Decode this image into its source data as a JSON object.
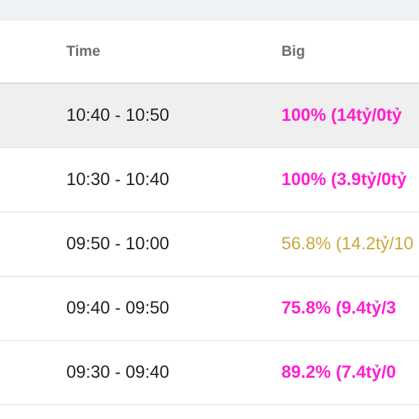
{
  "table": {
    "headers": {
      "time": "Time",
      "big": "Big"
    },
    "rows": [
      {
        "time": "10:40 - 10:50",
        "big": "100% (14tỷ/0tỷ",
        "status": "highlight",
        "selected": true
      },
      {
        "time": "10:30 - 10:40",
        "big": "100% (3.9tỷ/0tỷ",
        "status": "highlight",
        "selected": false
      },
      {
        "time": "09:50 - 10:00",
        "big": "56.8% (14.2tỷ/10",
        "status": "neutral",
        "selected": false
      },
      {
        "time": "09:40 - 09:50",
        "big": "75.8% (9.4tỷ/3",
        "status": "highlight",
        "selected": false
      },
      {
        "time": "09:30 - 09:40",
        "big": "89.2% (7.4tỷ/0",
        "status": "highlight",
        "selected": false
      }
    ]
  },
  "colors": {
    "highlight": "#ff1fd0",
    "neutral": "#c9a93a",
    "selected_row_bg": "#efefef"
  }
}
